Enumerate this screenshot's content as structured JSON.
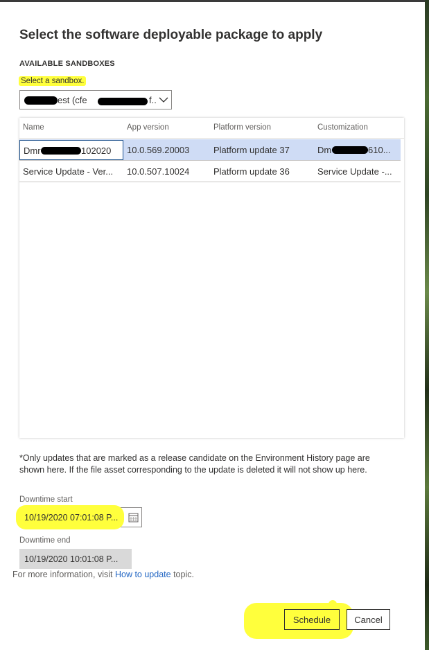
{
  "dialog": {
    "title": "Select the software deployable package to apply",
    "section_heading": "AVAILABLE SANDBOXES"
  },
  "sandbox": {
    "label": "Select a sandbox.",
    "selected_value": "est (cfe",
    "selected_value_tail": "f..."
  },
  "grid": {
    "columns": [
      "Name",
      "App version",
      "Platform version",
      "Customization"
    ],
    "rows": [
      {
        "name": "Dmr",
        "name_tail": "102020",
        "app_version": "10.0.569.20003",
        "platform_version": "Platform update 37",
        "customization": "Dm",
        "customization_tail": "610...",
        "selected": true
      },
      {
        "name": "Service Update - Ver...",
        "name_tail": "",
        "app_version": "10.0.507.10024",
        "platform_version": "Platform update 36",
        "customization": "Service Update -...",
        "customization_tail": "",
        "selected": false
      }
    ]
  },
  "footnote": "*Only updates that are marked as a release candidate on the Environment History page are shown here. If the file asset corresponding to the update is deleted it will not show up here.",
  "downtime_start": {
    "label": "Downtime start",
    "value": "10/19/2020 07:01:08 P..."
  },
  "downtime_end": {
    "label": "Downtime end",
    "value": "10/19/2020 10:01:08 P..."
  },
  "more_info": {
    "prefix": "For more information, visit",
    "link": "How to update",
    "suffix": "topic."
  },
  "buttons": {
    "schedule": "Schedule",
    "cancel": "Cancel"
  },
  "icons": {
    "dropdown": "chevron-down-icon",
    "calendar": "calendar-icon"
  },
  "colors": {
    "highlight": "#ffff3c",
    "selected_row": "#cfdcf5",
    "link": "#2266c3"
  }
}
